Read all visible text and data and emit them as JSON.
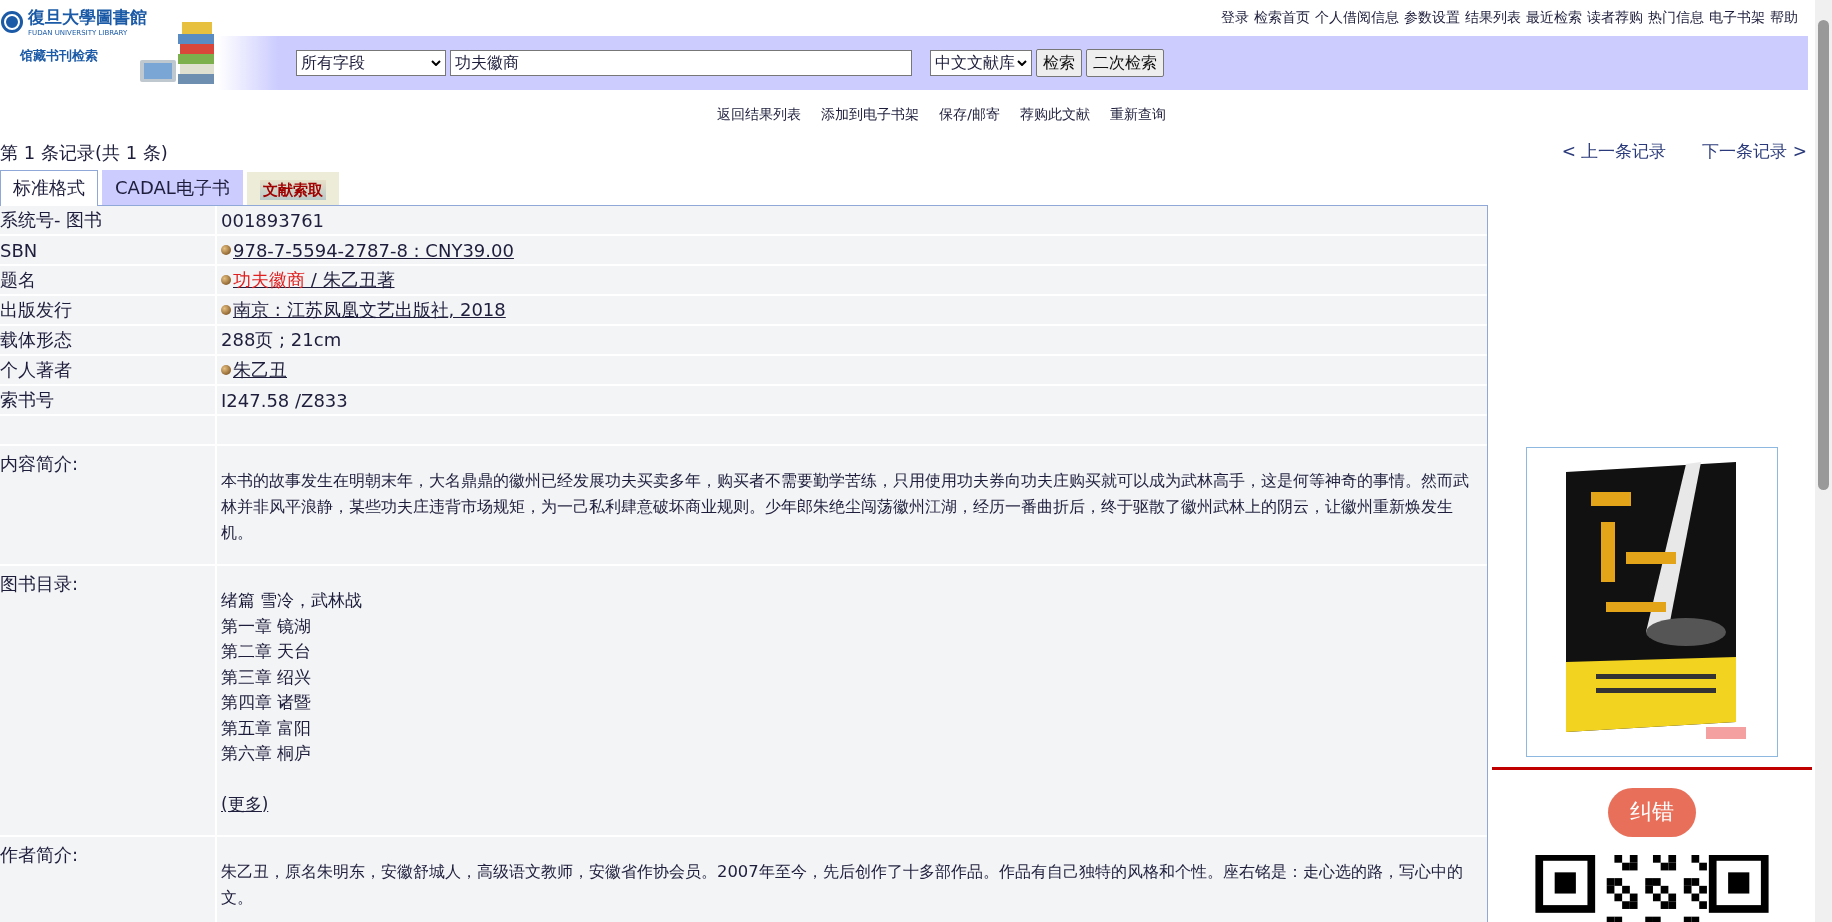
{
  "header": {
    "logo_title": "復旦大學圖書館",
    "logo_subtitle": "FUDAN UNIVERSITY LIBRARY",
    "system_name": "馆藏书刊检索",
    "top_links": [
      "登录",
      "检索首页",
      "个人借阅信息",
      "参数设置",
      "结果列表",
      "最近检索",
      "读者荐购",
      "热门信息",
      "电子书架",
      "帮助"
    ]
  },
  "search": {
    "field": "所有字段",
    "query": "功夫徽商",
    "database": "中文文献库",
    "buttons": [
      "检索",
      "二次检索"
    ]
  },
  "actions": [
    "返回结果列表",
    "添加到电子书架",
    "保存/邮寄",
    "荐购此文献",
    "重新查询"
  ],
  "record_count": "第 1 条记录(共 1 条)",
  "pager": {
    "prev": "< 上一条记录",
    "next": "下一条记录 >"
  },
  "tabs": [
    {
      "label": "标准格式",
      "selected": true,
      "kind": "text"
    },
    {
      "label": "CADAL电子书",
      "selected": false,
      "kind": "text"
    },
    {
      "label": "文献索取",
      "selected": false
    }
  ],
  "fields": [
    {
      "label": "系统号- 图书",
      "value": "001893761",
      "link": false
    },
    {
      "label": "SBN",
      "value": "978-7-5594-2787-8 : CNY39.00",
      "link": true
    },
    {
      "label": "题名",
      "highlight": "功夫徽商",
      "value": " / 朱乙丑著",
      "link": true
    },
    {
      "label": "出版发行",
      "value": "南京 : 江苏凤凰文艺出版社, 2018",
      "link": true
    },
    {
      "label": "载体形态",
      "value": "288页 ; 21cm",
      "link": false
    },
    {
      "label": "个人著者",
      "value": "朱乙丑",
      "link": true
    },
    {
      "label": "索书号",
      "value": "I247.58 /Z833",
      "link": false
    }
  ],
  "summary": {
    "label": "内容简介:",
    "text": "本书的故事发生在明朝末年，大名鼎鼎的徽州已经发展功夫买卖多年，购买者不需要勤学苦练，只用使用功夫券向功夫庄购买就可以成为武林高手，这是何等神奇的事情。然而武林并非风平浪静，某些功夫庄违背市场规矩，为一己私利肆意破坏商业规则。少年郎朱绝尘闯荡徽州江湖，经历一番曲折后，终于驱散了徽州武林上的阴云，让徽州重新焕发生机。"
  },
  "toc": {
    "label": "图书目录:",
    "lines": [
      "绪篇 雪冷，武林战",
      "第一章 镜湖",
      "第二章 天台",
      "第三章 绍兴",
      "第四章 诸暨",
      "第五章 富阳",
      "第六章 桐庐"
    ],
    "more": "(更多)"
  },
  "author": {
    "label": "作者简介:",
    "text": "朱乙丑，原名朱明东，安徽舒城人，高级语文教师，安徽省作协会员。2007年至今，先后创作了十多部作品。作品有自己独特的风格和个性。座右铭是：走心选的路，写心中的文。"
  },
  "sidebar": {
    "correction_button": "纠错"
  }
}
